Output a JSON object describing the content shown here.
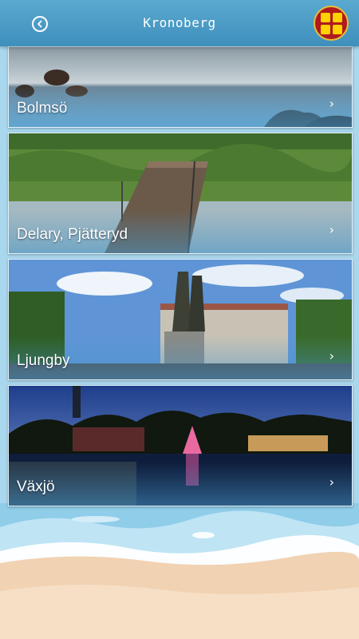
{
  "header": {
    "title": "Kronoberg",
    "back_icon": "back-arrow-icon",
    "menu_icon": "grid-menu-icon"
  },
  "colors": {
    "header": "#4a9dc8",
    "menu_button": "#b01a1e",
    "menu_squares": "#ffd200"
  },
  "destinations": [
    {
      "label": "Bolmsö",
      "chevron": "›"
    },
    {
      "label": "Delary, Pjätteryd",
      "chevron": "›"
    },
    {
      "label": "Ljungby",
      "chevron": "›"
    },
    {
      "label": "Växjö",
      "chevron": "›"
    }
  ]
}
